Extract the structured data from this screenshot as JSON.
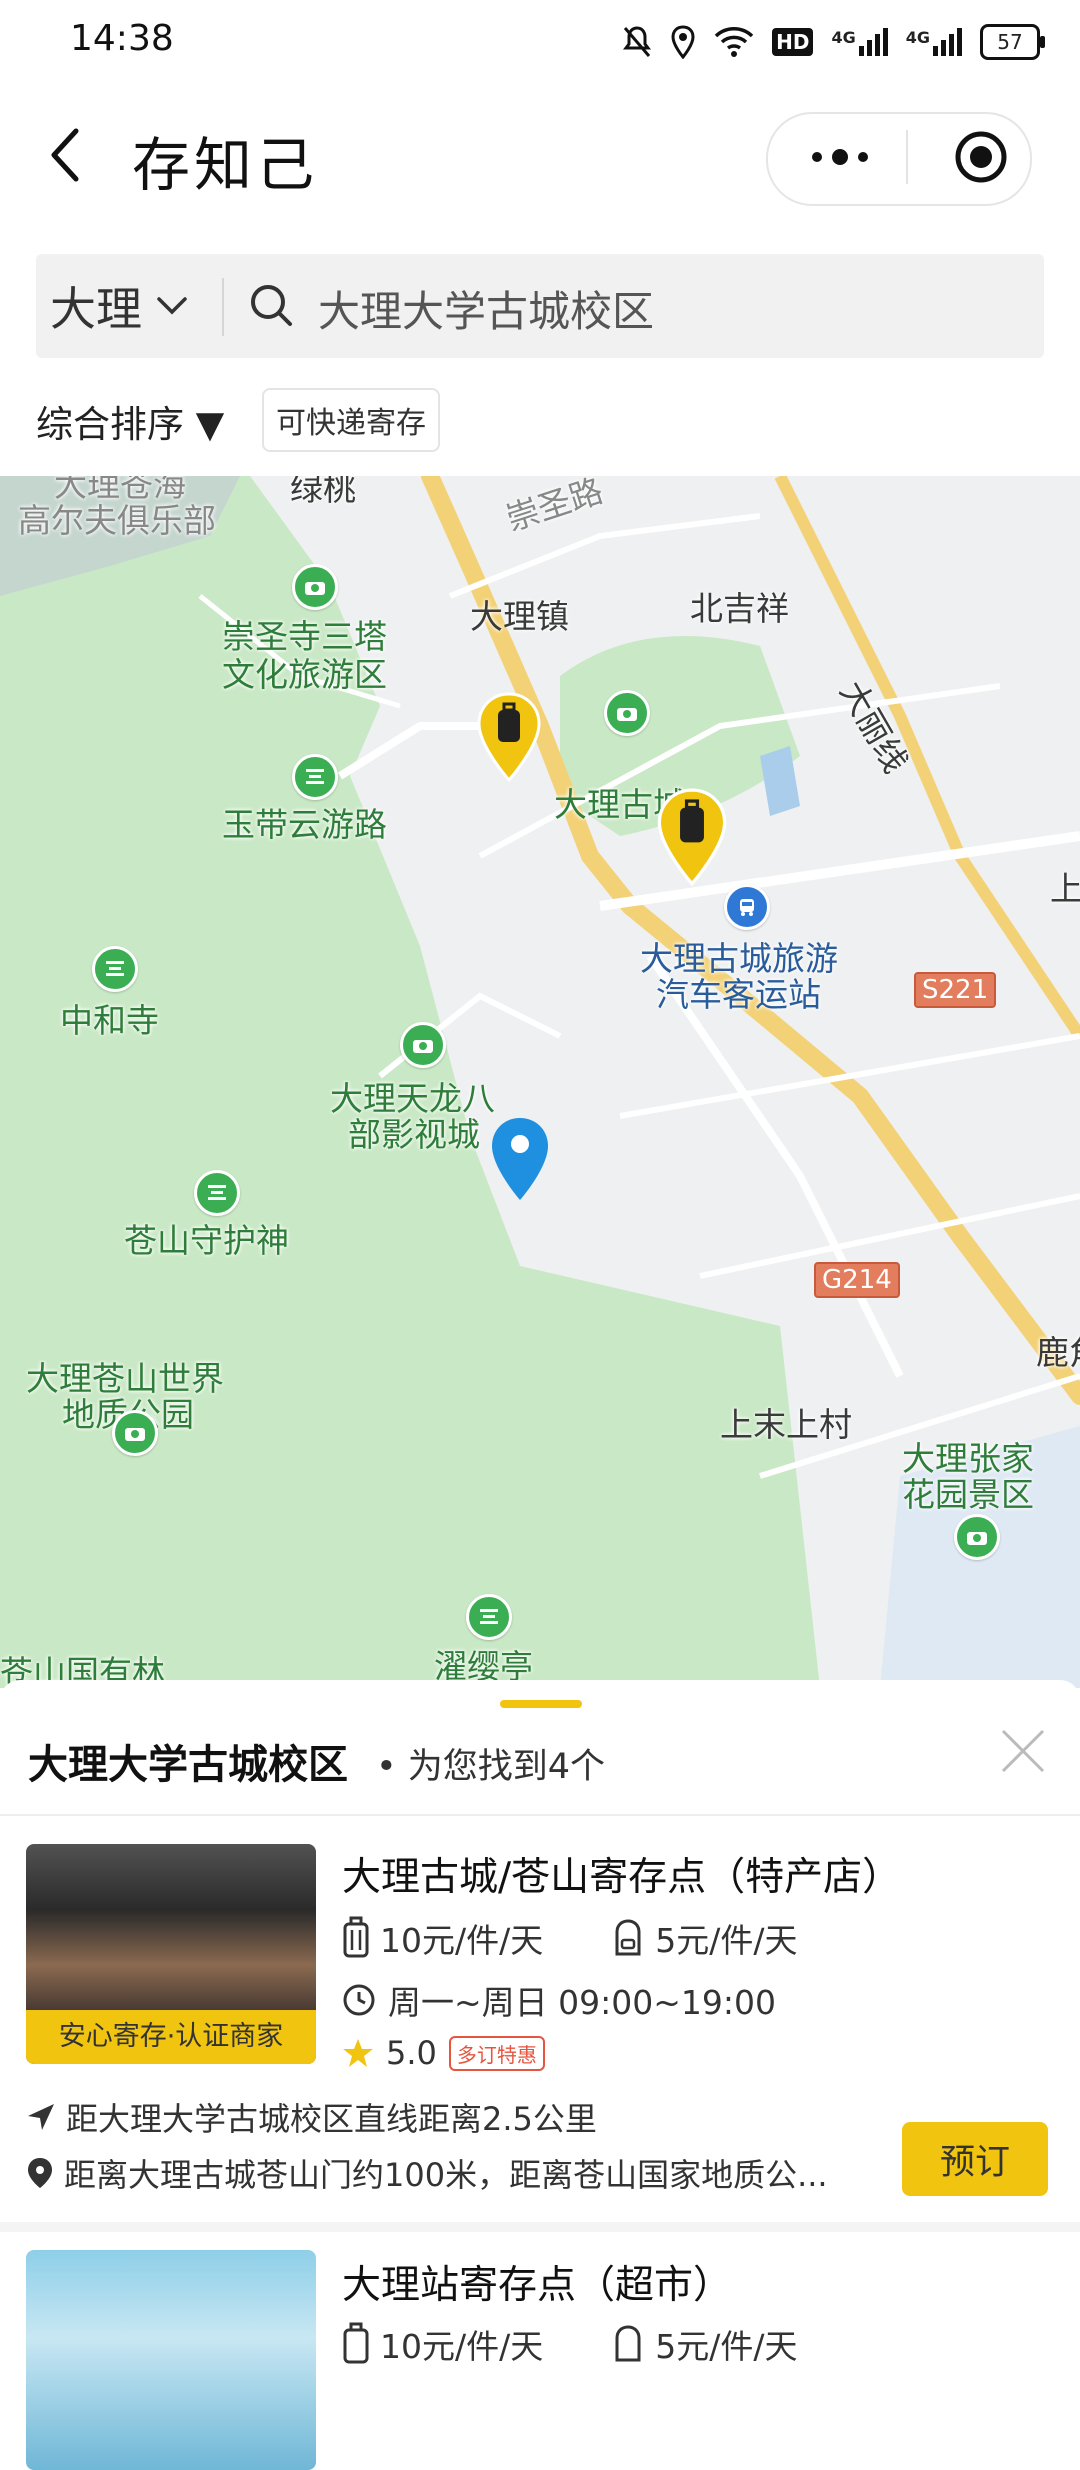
{
  "status": {
    "time": "14:38",
    "battery": "57",
    "network1": "4G",
    "network2": "4G",
    "hd": "HD"
  },
  "header": {
    "title": "存知己"
  },
  "search": {
    "city": "大理",
    "query": "大理大学古城校区"
  },
  "filters": {
    "sort_label": "综合排序 ▼",
    "express_tag": "可快递寄存"
  },
  "map": {
    "labels": [
      "大理苍海",
      "高尔夫俱乐部",
      "绿桃",
      "崇圣路",
      "崇圣寺三塔",
      "文化旅游区",
      "大理镇",
      "北吉祥",
      "大丽线",
      "大理古城",
      "玉带云游路",
      "大理古城旅游",
      "汽车客运站",
      "中和寺",
      "大理天龙八",
      "部影视城",
      "苍山守护神",
      "大理苍山世界",
      "地质公园",
      "上末上村",
      "大理张家",
      "花园景区",
      "濯缨亭",
      "苍山国有林",
      "上",
      "鹿角"
    ],
    "road_shields": [
      "S221",
      "G214"
    ],
    "colors": {
      "park": "#c9e8c5",
      "road_major": "#f3d176",
      "marker_yellow": "#f1c40f",
      "marker_blue": "#1f8fe0"
    }
  },
  "results": {
    "title": "大理大学古城校区",
    "count_text": "• 为您找到4个",
    "listings": [
      {
        "name": "大理古城/苍山寄存点（特产店）",
        "badge": "安心寄存·认证商家",
        "price_luggage": "10元/件/天",
        "price_bag": "5元/件/天",
        "hours": "周一~周日 09:00~19:00",
        "rating": "5.0",
        "promo": "多订特惠",
        "distance": "距大理大学古城校区直线距离2.5公里",
        "address": "距离大理古城苍山门约100米，距离苍山国家地质公...",
        "book_label": "预订"
      },
      {
        "name": "大理站寄存点（超市）",
        "price_luggage": "10元/件/天",
        "price_bag": "5元/件/天"
      }
    ]
  }
}
